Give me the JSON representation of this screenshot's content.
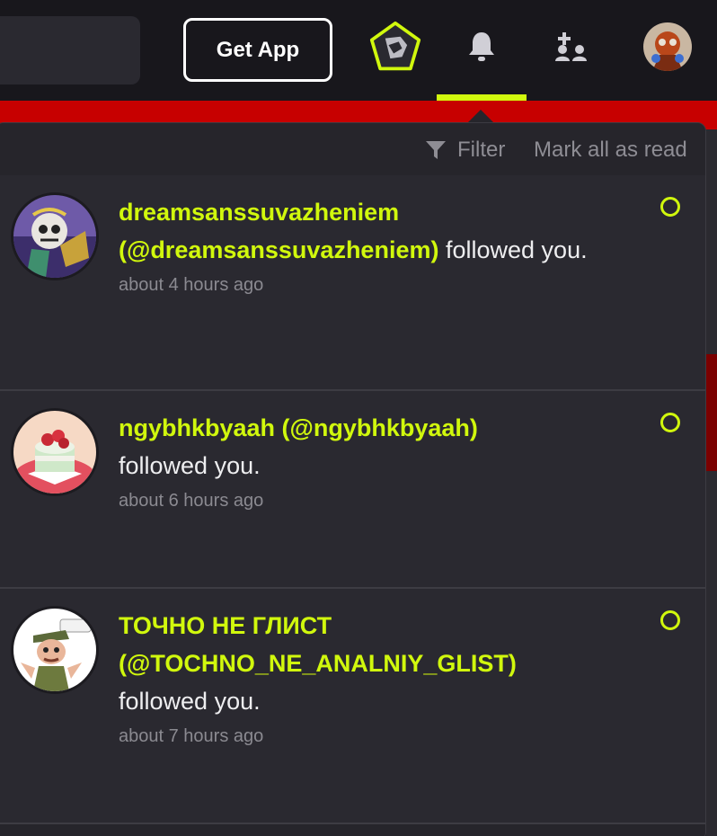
{
  "header": {
    "get_app_label": "Get App",
    "icons": [
      "blocks-icon",
      "bell-icon",
      "friends-icon"
    ],
    "active_tab": "notifications"
  },
  "colors": {
    "accent": "#d1f80d",
    "background": "#18171c",
    "panel": "#2a2930",
    "banner": "#c70000"
  },
  "notifications": {
    "filter_label": "Filter",
    "mark_all_read_label": "Mark all as read",
    "items": [
      {
        "user": "dreamsanssuvazheniem (@dreamsanssuvazheniem)",
        "action": "followed you.",
        "time": "about 4 hours ago",
        "unread": true
      },
      {
        "user": "ngybhkbyaah (@ngybhkbyaah)",
        "action": "followed you.",
        "time": "about 6 hours ago",
        "unread": true
      },
      {
        "user": "ТОЧНО НЕ ГЛИСТ (@TOCHNO_NE_ANALNIY_GLIST)",
        "action": "followed you.",
        "time": "about 7 hours ago",
        "unread": true
      }
    ]
  }
}
